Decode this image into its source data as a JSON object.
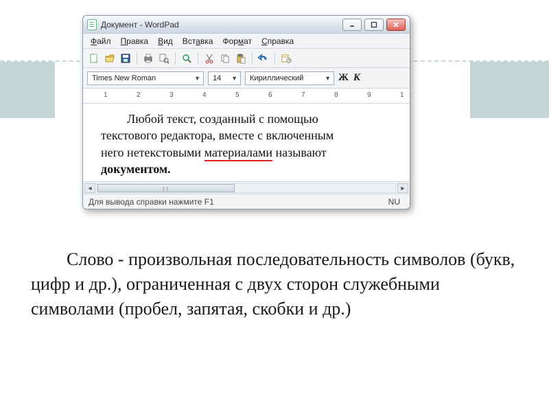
{
  "window": {
    "title": "Документ - WordPad",
    "controls": {
      "min_icon": "minimize-icon",
      "max_icon": "maximize-icon",
      "close_icon": "close-icon"
    }
  },
  "menubar": {
    "items": [
      {
        "full": "Файл",
        "u": "Ф",
        "rest": "айл"
      },
      {
        "full": "Правка",
        "u": "П",
        "rest": "равка"
      },
      {
        "full": "Вид",
        "u": "В",
        "rest": "ид"
      },
      {
        "full": "Вставка",
        "u": "",
        "rest": "Вст",
        "u2": "а",
        "rest2": "вка"
      },
      {
        "full": "Формат",
        "u": "",
        "rest": "Фор",
        "u2": "м",
        "rest2": "ат"
      },
      {
        "full": "Справка",
        "u": "С",
        "rest": "правка"
      }
    ]
  },
  "toolbar": {
    "icons": [
      "new-icon",
      "open-icon",
      "save-icon",
      "sep",
      "print-icon",
      "print-preview-icon",
      "sep",
      "find-icon",
      "sep",
      "cut-icon",
      "copy-icon",
      "paste-icon",
      "sep",
      "undo-icon",
      "sep",
      "datetime-icon"
    ]
  },
  "format_bar": {
    "font": "Times New Roman",
    "size": "14",
    "script": "Кириллический",
    "bold_label": "Ж",
    "italic_label": "К"
  },
  "ruler": {
    "marks": [
      "1",
      "2",
      "3",
      "4",
      "5",
      "6",
      "7",
      "8",
      "9",
      "1"
    ]
  },
  "document": {
    "line1a": "Любой текст, созданный с помощью",
    "line2": "текстового редактора, вместе с включенным",
    "line3a": "него нетекстовыми ",
    "line3_underlined": "материалами",
    "line3b": " называют",
    "line4": "документом."
  },
  "statusbar": {
    "hint": "Для вывода справки нажмите F1",
    "indicator": "NU"
  },
  "caption": {
    "text": "Слово - произвольная последовательность символов (букв, цифр и др.), ограниченная с двух сторон служебными символами (пробел, запятая, скобки и др.)"
  }
}
